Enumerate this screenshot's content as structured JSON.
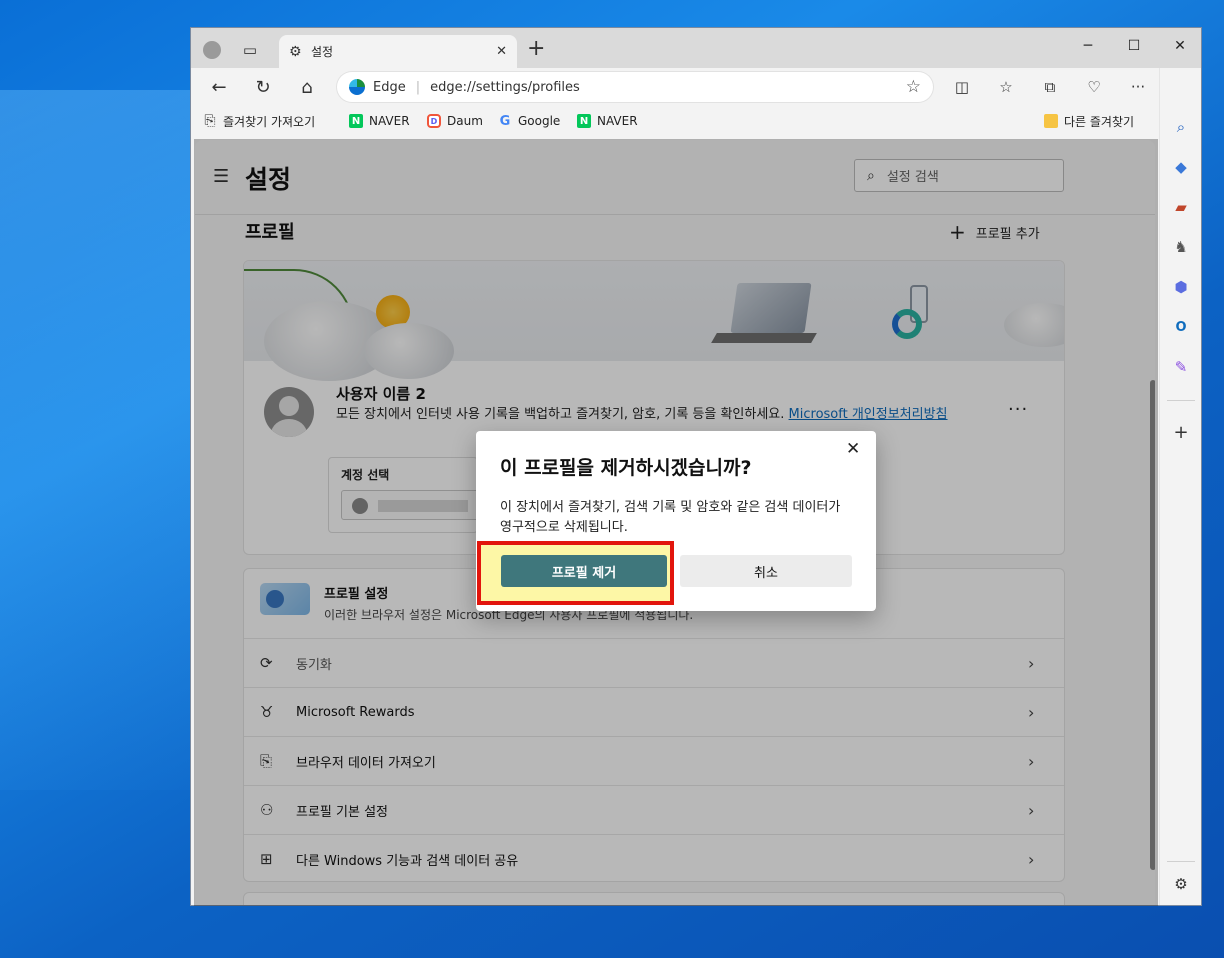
{
  "tab": {
    "title": "설정"
  },
  "window_controls": {
    "minimize": "─",
    "maximize": "☐",
    "close": "✕"
  },
  "address": {
    "brand": "Edge",
    "url": "edge://settings/profiles"
  },
  "favorites": {
    "import_label": "즐겨찾기 가져오기",
    "items": [
      {
        "label": "NAVER",
        "icon": "naver-icon"
      },
      {
        "label": "Daum",
        "icon": "daum-icon"
      },
      {
        "label": "Google",
        "icon": "google-icon"
      },
      {
        "label": "NAVER",
        "icon": "naver-icon"
      }
    ],
    "other_label": "다른 즐겨찾기"
  },
  "settings": {
    "title": "설정",
    "search_placeholder": "설정 검색",
    "section_title": "프로필",
    "add_profile": "프로필 추가"
  },
  "profile": {
    "name": "사용자 이름 2",
    "desc_text": "모든 장치에서 인터넷 사용 기록을 백업하고 즐겨찾기, 암호, 기록 등을 확인하세요. ",
    "desc_link": "Microsoft 개인정보처리방침",
    "account_label": "계정 선택"
  },
  "profile_settings": {
    "title": "프로필 설정",
    "desc": "이러한 브라우저 설정은 Microsoft Edge의 사용자 프로필에 적용됩니다.",
    "rows": [
      {
        "label": "동기화",
        "icon": "sync-icon"
      },
      {
        "label": "Microsoft Rewards",
        "icon": "rewards-icon"
      },
      {
        "label": "브라우저 데이터 가져오기",
        "icon": "import-icon"
      },
      {
        "label": "프로필 기본 설정",
        "icon": "profile-prefs-icon"
      },
      {
        "label": "다른 Windows 기능과 검색 데이터 공유",
        "icon": "windows-icon"
      }
    ]
  },
  "dialog": {
    "title": "이 프로필을 제거하시겠습니까?",
    "message": "이 장치에서 즐겨찾기, 검색 기록 및 암호와 같은 검색 데이터가 영구적으로 삭제됩니다.",
    "confirm": "프로필 제거",
    "cancel": "취소"
  },
  "colors": {
    "remove_button": "#3f777c",
    "highlight_border": "#e2150c",
    "highlight_fill": "#fdf7a6",
    "link": "#0f6cbd"
  }
}
